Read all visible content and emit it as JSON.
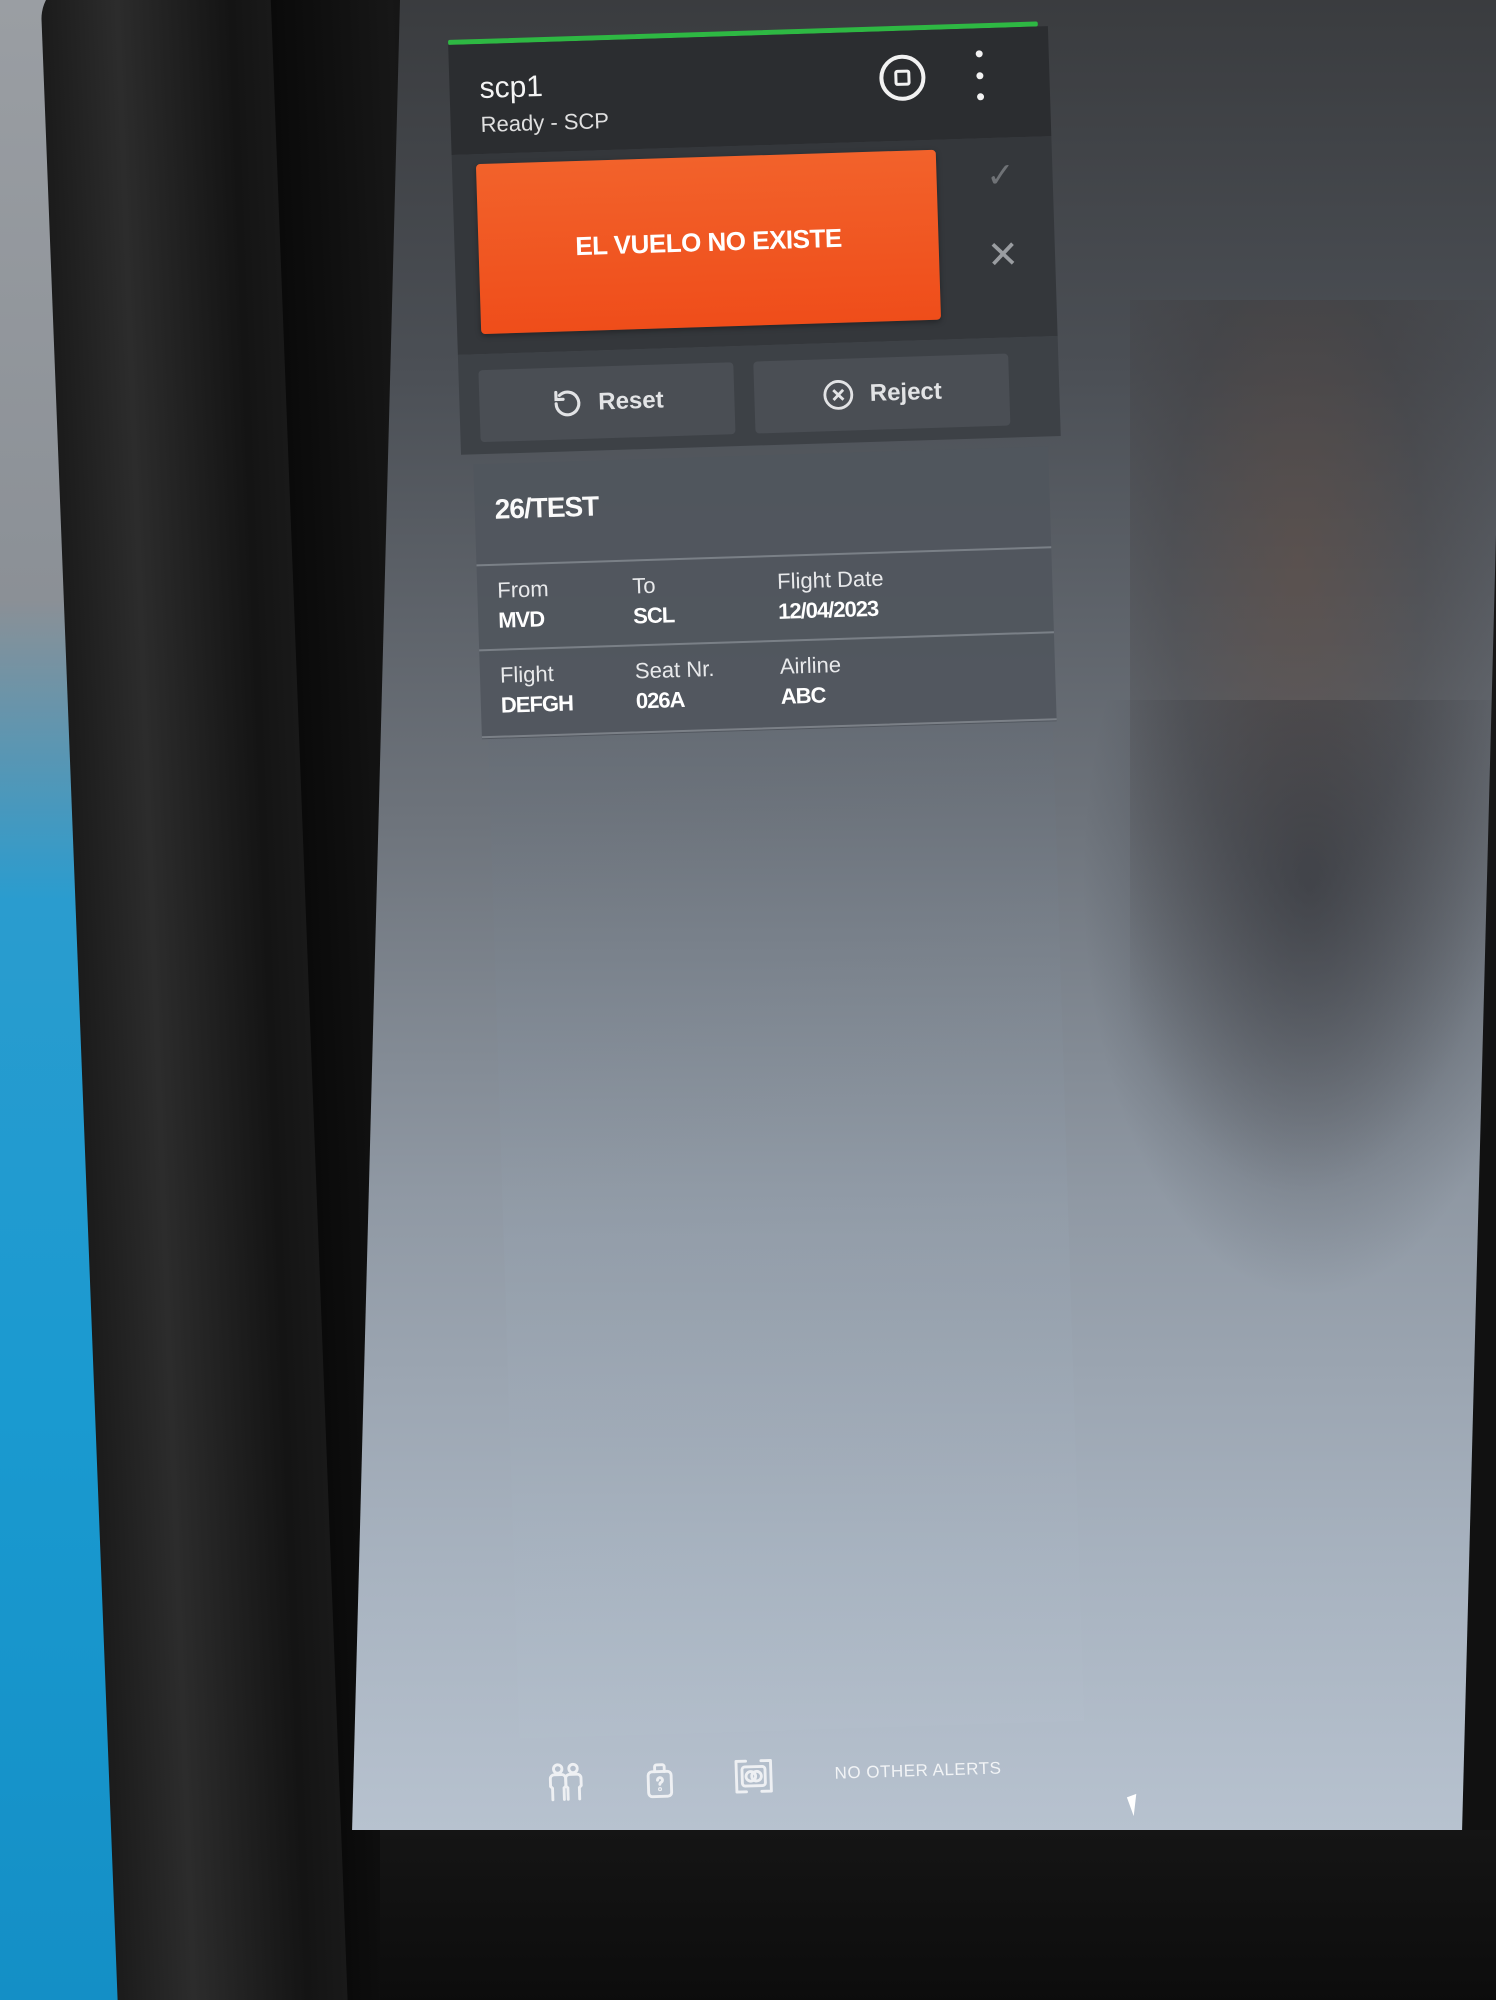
{
  "header": {
    "device_name": "scp1",
    "device_status": "Ready - SCP",
    "stop_icon": "stop-circle-icon",
    "menu_icon": "more-vertical-icon"
  },
  "alert": {
    "message": "EL VUELO NO EXISTE",
    "color": "#ef4d1a",
    "accept_icon": "check-icon",
    "dismiss_icon": "close-icon"
  },
  "actions": {
    "reset_label": "Reset",
    "reject_label": "Reject"
  },
  "flight": {
    "title": "26/TEST",
    "from_label": "From",
    "from_value": "MVD",
    "to_label": "To",
    "to_value": "SCL",
    "date_label": "Flight Date",
    "date_value": "12/04/2023",
    "flight_label": "Flight",
    "flight_value": "DEFGH",
    "seat_label": "Seat Nr.",
    "seat_value": "026A",
    "airline_label": "Airline",
    "airline_value": "ABC"
  },
  "footer": {
    "icons": [
      "passengers-icon",
      "baggage-icon",
      "document-scan-icon"
    ],
    "alerts_text": "NO OTHER ALERTS"
  },
  "colors": {
    "status_line": "#2eb843",
    "alert_bg": "#ef4d1a"
  }
}
